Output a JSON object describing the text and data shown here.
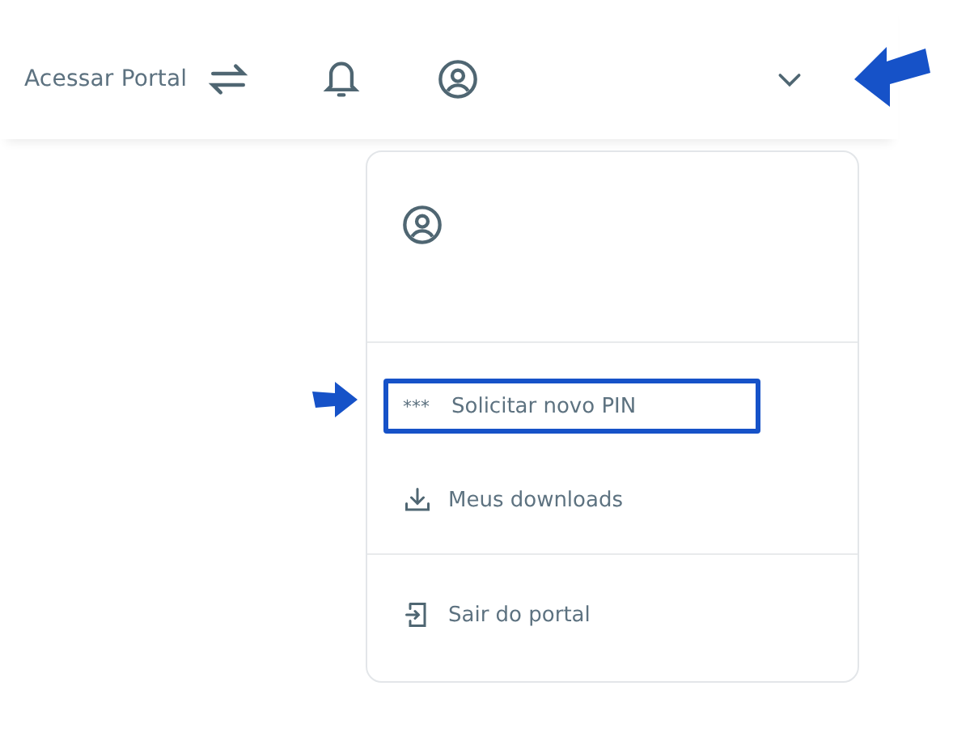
{
  "header": {
    "portal_link": "Acessar Portal",
    "annotated": true
  },
  "menu": {
    "sections": [
      {
        "items": [
          {
            "kind": "asterisks",
            "icon_text": "***",
            "label": "Solicitar novo PIN",
            "annotated": true
          },
          {
            "kind": "download",
            "label": "Meus downloads",
            "annotated": false
          }
        ]
      },
      {
        "items": [
          {
            "kind": "logout",
            "label": "Sair do portal",
            "annotated": false
          }
        ]
      }
    ]
  }
}
